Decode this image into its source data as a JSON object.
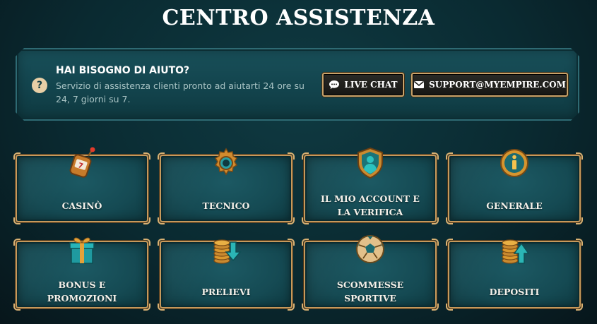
{
  "page": {
    "title": "CENTRO ASSISTENZA"
  },
  "help": {
    "title": "HAI BISOGNO DI AIUTO?",
    "description": "Servizio di assistenza clienti pronto ad aiutarti 24 ore su 24, 7 giorni su 7.",
    "icon": "question-icon"
  },
  "actions": {
    "live_chat": {
      "label": "LIVE CHAT",
      "icon": "chat-bubble-icon"
    },
    "email": {
      "label": "SUPPORT@MYEMPIRE.COM",
      "icon": "envelope-icon"
    }
  },
  "categories": [
    {
      "label": "CASINÒ",
      "icon": "slot-machine-icon"
    },
    {
      "label": "TECNICO",
      "icon": "gear-icon"
    },
    {
      "label": "IL MIO ACCOUNT E\nLA VERIFICA",
      "icon": "user-shield-icon"
    },
    {
      "label": "GENERALE",
      "icon": "info-icon"
    },
    {
      "label": "BONUS E\nPROMOZIONI",
      "icon": "gift-box-icon"
    },
    {
      "label": "PRELIEVI",
      "icon": "coins-down-arrow-icon"
    },
    {
      "label": "SCOMMESSE\nSPORTIVE",
      "icon": "football-icon"
    },
    {
      "label": "DEPOSITI",
      "icon": "coins-up-arrow-icon"
    }
  ],
  "colors": {
    "background": "#0a2a31",
    "gold_border": "#c6995c",
    "card_teal": "#154a53",
    "accent_cyan": "#2bb5b5"
  }
}
